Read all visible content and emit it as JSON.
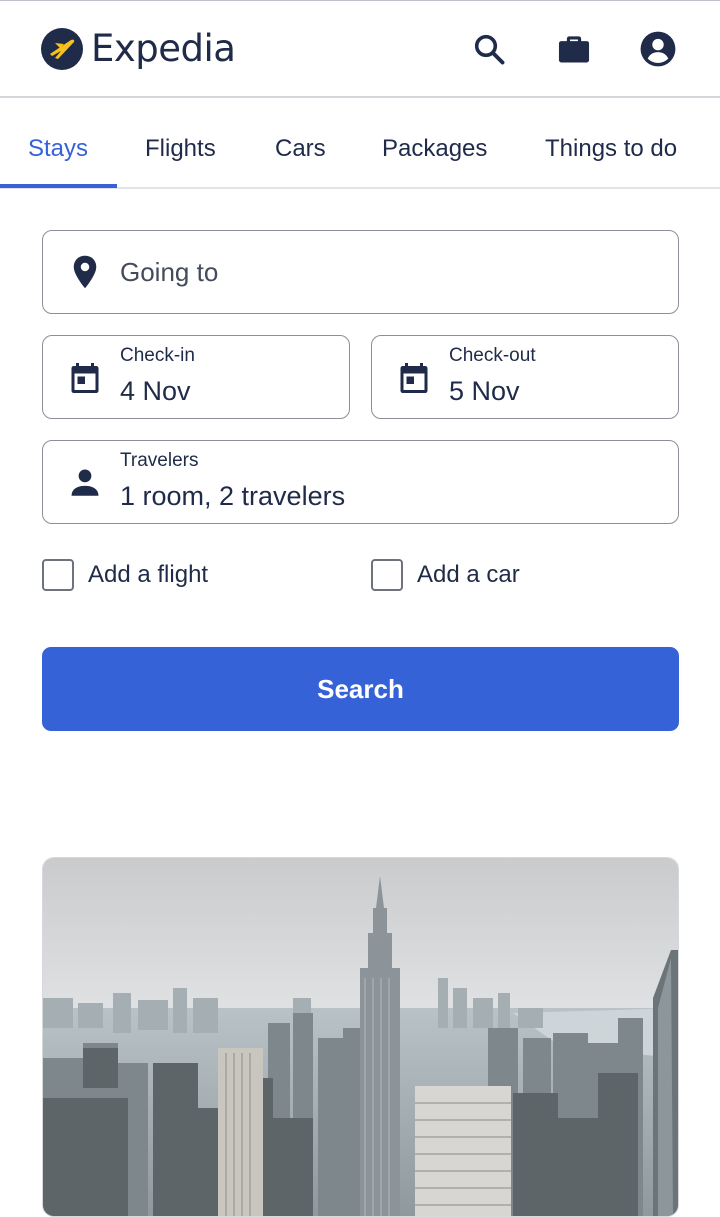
{
  "app": {
    "brand_name": "Expedia",
    "accent_color": "#3662d8",
    "text_color": "#1f2b49",
    "logo_color": "#f8c21c"
  },
  "header": {
    "icons": [
      "search-icon",
      "briefcase-icon",
      "account-icon"
    ]
  },
  "tabs": [
    {
      "label": "Stays",
      "active": true
    },
    {
      "label": "Flights",
      "active": false
    },
    {
      "label": "Cars",
      "active": false
    },
    {
      "label": "Packages",
      "active": false
    },
    {
      "label": "Things to do",
      "active": false
    }
  ],
  "search_form": {
    "destination": {
      "placeholder": "Going to",
      "icon": "location-pin-icon"
    },
    "check_in": {
      "label": "Check-in",
      "value": "4 Nov",
      "icon": "calendar-icon"
    },
    "check_out": {
      "label": "Check-out",
      "value": "5 Nov",
      "icon": "calendar-icon"
    },
    "travelers": {
      "label": "Travelers",
      "value": "1 room, 2 travelers",
      "icon": "person-icon"
    },
    "add_flight": {
      "label": "Add a flight",
      "checked": false
    },
    "add_car": {
      "label": "Add a car",
      "checked": false
    },
    "search_button": "Search"
  }
}
